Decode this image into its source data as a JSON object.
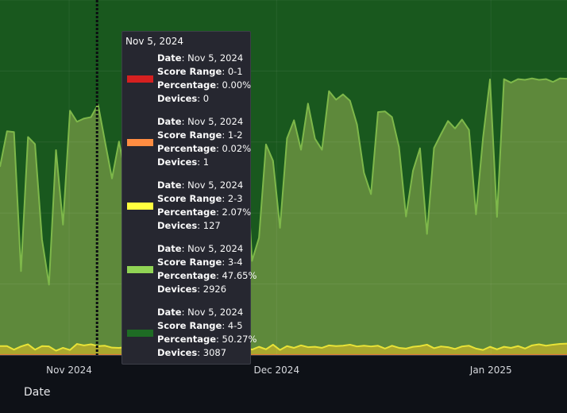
{
  "chart_data": {
    "type": "area",
    "stacked": true,
    "normalized_percent": true,
    "x_axis": {
      "title": "Date",
      "tick_labels": [
        {
          "label": "Nov 2024",
          "date": "2024-11-01"
        },
        {
          "label": "Dec 2024",
          "date": "2024-12-01"
        },
        {
          "label": "Jan 2025",
          "date": "2025-01-01"
        }
      ],
      "range": [
        "2024-10-22",
        "2025-01-12"
      ]
    },
    "y_range": [
      0,
      100
    ],
    "grid": true,
    "colors": {
      "0-1": "#b91c1c",
      "1-2": "#e07b39",
      "2-3": "#e8e337",
      "3-4": "#7eb84a",
      "4-5": "#1a5e1f"
    },
    "x_start": "2024-10-22",
    "x_end": "2025-01-12",
    "series": [
      {
        "name": "0-1",
        "values": [
          0.0,
          0.0,
          0.0,
          0.0,
          0.0,
          0.0,
          0.0,
          0.0,
          0.0,
          0.0,
          0.0,
          0.0,
          0.0,
          0.0,
          0.0,
          0.0,
          0.0,
          0.0,
          0.0,
          0.0,
          0.0,
          0.0,
          0.0,
          0.0,
          0.0,
          0.0,
          0.0,
          0.0,
          0.0,
          0.0,
          0.0,
          0.0,
          0.0,
          0.0,
          0.0,
          0.0,
          0.0,
          0.0,
          0.0,
          0.0,
          0.0,
          0.0,
          0.0,
          0.0,
          0.0,
          0.0,
          0.0,
          0.0,
          0.0,
          0.0,
          0.0,
          0.0,
          0.0,
          0.0,
          0.0,
          0.0,
          0.0,
          0.0,
          0.0,
          0.0,
          0.0,
          0.0,
          0.0,
          0.0,
          0.0,
          0.0,
          0.0,
          0.0,
          0.0,
          0.0,
          0.0,
          0.0,
          0.0,
          0.0,
          0.0,
          0.0,
          0.0,
          0.0,
          0.0,
          0.0,
          0.0,
          0.0
        ]
      },
      {
        "name": "1-2",
        "values": [
          0.02,
          0.02,
          0.02,
          0.02,
          0.02,
          0.02,
          0.02,
          0.02,
          0.02,
          0.02,
          0.02,
          0.02,
          0.02,
          0.02,
          0.02,
          0.02,
          0.02,
          0.02,
          0.02,
          0.02,
          0.02,
          0.02,
          0.02,
          0.02,
          0.02,
          0.02,
          0.02,
          0.02,
          0.02,
          0.02,
          0.02,
          0.02,
          0.02,
          0.02,
          0.02,
          0.02,
          0.02,
          0.02,
          0.02,
          0.02,
          0.02,
          0.02,
          0.02,
          0.02,
          0.02,
          0.02,
          0.02,
          0.02,
          0.02,
          0.02,
          0.02,
          0.02,
          0.02,
          0.02,
          0.02,
          0.02,
          0.02,
          0.02,
          0.02,
          0.02,
          0.02,
          0.02,
          0.02,
          0.02,
          0.02,
          0.02,
          0.02,
          0.02,
          0.02,
          0.02,
          0.02,
          0.02,
          0.02,
          0.02,
          0.02,
          0.02,
          0.02,
          0.02,
          0.02,
          0.02,
          0.02,
          0.02
        ]
      },
      {
        "name": "2-3",
        "values": [
          2.5,
          2.5,
          1.5,
          2.4,
          3.0,
          1.5,
          2.5,
          2.4,
          1.2,
          2.0,
          1.4,
          3.1,
          2.7,
          3.0,
          2.5,
          2.6,
          2.07,
          2.0,
          2.2,
          2.9,
          2.1,
          1.5,
          2.6,
          2.3,
          1.4,
          2.5,
          2.6,
          2.4,
          2.0,
          2.1,
          3.1,
          2.3,
          1.9,
          1.4,
          3.0,
          2.3,
          1.5,
          2.3,
          1.6,
          2.9,
          1.4,
          2.5,
          2.0,
          2.7,
          2.2,
          2.3,
          2.0,
          2.7,
          2.5,
          2.6,
          2.9,
          2.4,
          2.6,
          2.4,
          2.6,
          1.8,
          2.6,
          2.0,
          1.8,
          2.3,
          2.5,
          2.9,
          1.9,
          2.4,
          2.2,
          1.7,
          2.4,
          2.6,
          1.8,
          1.4,
          2.3,
          1.6,
          2.3,
          2.0,
          2.5,
          1.8,
          2.7,
          3.0,
          2.6,
          2.9,
          3.1,
          3.2
        ]
      },
      {
        "name": "3-4",
        "values": [
          50.5,
          60.5,
          61.3,
          21.2,
          58.4,
          57.9,
          30.0,
          17.4,
          56.5,
          34.7,
          67.4,
          62.6,
          63.9,
          64.0,
          68.1,
          57.5,
          47.65,
          58.1,
          47.8,
          32.4,
          47.5,
          55.2,
          49.9,
          37.4,
          58.4,
          54.1,
          17.1,
          59.4,
          43.1,
          46.0,
          21.6,
          56.7,
          58.5,
          33.4,
          17.8,
          59.8,
          25.0,
          30.7,
          57.7,
          51.8,
          34.4,
          58.5,
          64.1,
          55.1,
          68.6,
          58.6,
          55.8,
          71.6,
          69.4,
          70.8,
          68.7,
          62.5,
          48.7,
          42.9,
          65.8,
          66.8,
          64.4,
          56.6,
          37.2,
          49.6,
          55.7,
          31.2,
          56.4,
          59.8,
          63.7,
          62.1,
          63.9,
          60.8,
          37.8,
          59.7,
          75.3,
          37.3,
          75.4,
          74.7,
          75.2,
          75.7,
          75.2,
          74.5,
          75.1,
          74.0,
          74.8,
          74.6
        ]
      },
      {
        "name": "4-5",
        "values": [
          46.98,
          36.98,
          37.18,
          76.38,
          38.58,
          40.58,
          67.48,
          80.18,
          42.28,
          63.28,
          31.18,
          34.28,
          33.38,
          32.98,
          29.38,
          39.88,
          50.27,
          39.88,
          49.98,
          64.68,
          50.38,
          43.28,
          47.48,
          60.28,
          40.18,
          43.38,
          80.28,
          38.18,
          54.88,
          51.88,
          75.28,
          40.98,
          39.58,
          65.18,
          79.18,
          37.88,
          73.48,
          67.38,
          40.68,
          45.28,
          64.18,
          38.98,
          33.88,
          42.18,
          29.18,
          39.08,
          42.18,
          25.68,
          28.08,
          26.58,
          28.38,
          35.08,
          48.68,
          54.68,
          31.58,
          31.38,
          32.98,
          41.38,
          60.98,
          48.08,
          41.78,
          65.88,
          41.68,
          37.78,
          34.08,
          36.18,
          33.68,
          36.58,
          60.38,
          38.88,
          22.38,
          61.08,
          22.28,
          23.28,
          22.28,
          22.48,
          22.08,
          22.48,
          22.28,
          23.08,
          22.08,
          22.18
        ]
      }
    ],
    "hover_line": {
      "date": "2024-11-05"
    },
    "tooltip": {
      "title": "Nov 5, 2024",
      "entries": [
        {
          "date": "Nov 5, 2024",
          "score_range": "0-1",
          "percentage": "0.00%",
          "devices": "0",
          "color": "#b91c1c"
        },
        {
          "date": "Nov 5, 2024",
          "score_range": "1-2",
          "percentage": "0.02%",
          "devices": "1",
          "color": "#e07b39"
        },
        {
          "date": "Nov 5, 2024",
          "score_range": "2-3",
          "percentage": "2.07%",
          "devices": "127",
          "color": "#e8e337"
        },
        {
          "date": "Nov 5, 2024",
          "score_range": "3-4",
          "percentage": "47.65%",
          "devices": "2926",
          "color": "#7eb84a"
        },
        {
          "date": "Nov 5, 2024",
          "score_range": "4-5",
          "percentage": "50.27%",
          "devices": "3087",
          "color": "#1a5e1f"
        }
      ],
      "field_labels": {
        "date": "Date",
        "score_range": "Score Range",
        "percentage": "Percentage",
        "devices": "Devices"
      }
    }
  }
}
